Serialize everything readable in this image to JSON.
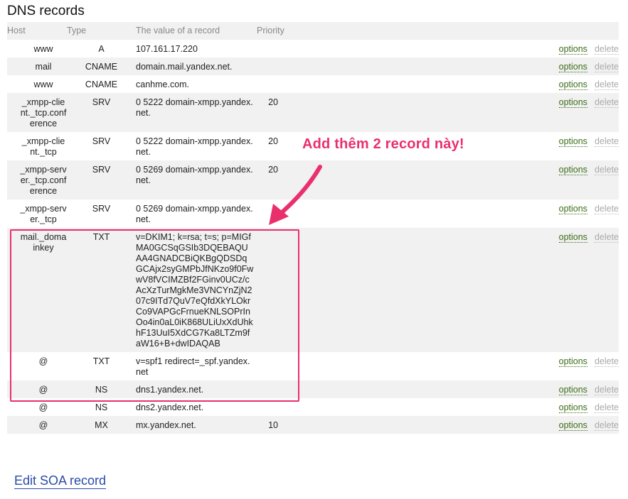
{
  "page_title": "DNS records",
  "columns": {
    "host": "Host",
    "type": "Type",
    "value": "The value of a record",
    "priority": "Priority"
  },
  "actions": {
    "options": "options",
    "delete": "delete"
  },
  "records": [
    {
      "host": "www",
      "type": "A",
      "value": "107.161.17.220",
      "priority": ""
    },
    {
      "host": "mail",
      "type": "CNAME",
      "value": "domain.mail.yandex.net.",
      "priority": ""
    },
    {
      "host": "www",
      "type": "CNAME",
      "value": "canhme.com.",
      "priority": ""
    },
    {
      "host": "_xmpp-client._tcp.conference",
      "type": "SRV",
      "value": "0 5222 domain-xmpp.yandex.net.",
      "priority": "20"
    },
    {
      "host": "_xmpp-client._tcp",
      "type": "SRV",
      "value": "0 5222 domain-xmpp.yandex.net.",
      "priority": "20"
    },
    {
      "host": "_xmpp-server._tcp.conference",
      "type": "SRV",
      "value": "0 5269 domain-xmpp.yandex.net.",
      "priority": "20"
    },
    {
      "host": "_xmpp-server._tcp",
      "type": "SRV",
      "value": "0 5269 domain-xmpp.yandex.net.",
      "priority": ""
    },
    {
      "host": "mail._domainkey",
      "type": "TXT",
      "value": "v=DKIM1; k=rsa; t=s; p=MIGfMA0GCSqGSIb3DQEBAQUAA4GNADCBiQKBgQDSDqGCAjx2syGMPbJfNKzo9f0FwwV8fVCIMZBf2FGinv0UCz/cAcXzTurMgkMe3VNCYnZjN207c9ITd7QuV7eQfdXkYLOkrCo9VAPGcFrnueKNLSOPrInOo4in0aL0iK868ULiUxXdUhkhF13UuI5XdCG7Ka8LTZm9faW16+B+dwIDAQAB",
      "priority": ""
    },
    {
      "host": "@",
      "type": "TXT",
      "value": "v=spf1 redirect=_spf.yandex.net",
      "priority": ""
    },
    {
      "host": "@",
      "type": "NS",
      "value": "dns1.yandex.net.",
      "priority": ""
    },
    {
      "host": "@",
      "type": "NS",
      "value": "dns2.yandex.net.",
      "priority": ""
    },
    {
      "host": "@",
      "type": "MX",
      "value": "mx.yandex.net.",
      "priority": "10"
    }
  ],
  "edit_soa": "Edit SOA record",
  "annotation": "Add thêm 2 record này!",
  "colors": {
    "annotation": "#ea2f6d",
    "options_link": "#3d6e1a",
    "edit_link": "#2a4ba8"
  }
}
